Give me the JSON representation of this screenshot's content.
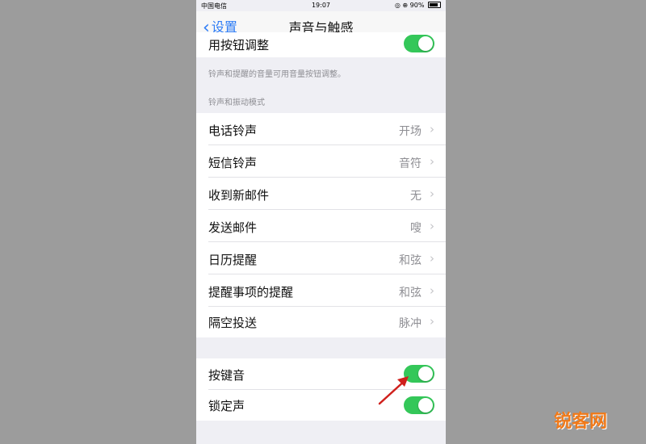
{
  "status_bar": {
    "carrier": "中国电信",
    "wifi_icon": "wifi-icon",
    "time": "19:07",
    "right_text": "◎ ⊕ 90%"
  },
  "nav": {
    "back_label": "设置",
    "title": "声音与触感"
  },
  "volume_buttons": {
    "label": "用按钮调整",
    "enabled": true,
    "footnote": "铃声和提醒的音量可用音量按钮调整。"
  },
  "ringtones": {
    "header": "铃声和振动模式",
    "items": [
      {
        "label": "电话铃声",
        "value": "开场"
      },
      {
        "label": "短信铃声",
        "value": "音符"
      },
      {
        "label": "收到新邮件",
        "value": "无"
      },
      {
        "label": "发送邮件",
        "value": "嗖"
      },
      {
        "label": "日历提醒",
        "value": "和弦"
      },
      {
        "label": "提醒事项的提醒",
        "value": "和弦"
      },
      {
        "label": "隔空投送",
        "value": "脉冲"
      }
    ]
  },
  "feedback": {
    "items": [
      {
        "label": "按键音",
        "enabled": true
      },
      {
        "label": "锁定声",
        "enabled": true
      }
    ]
  },
  "chevron_glyph": "›",
  "colors": {
    "toggle_on": "#34c759",
    "annotation_arrow": "#d0201c",
    "accent": "#2d7cf6",
    "watermark": "#f07a1a"
  },
  "watermark": "锐客网"
}
